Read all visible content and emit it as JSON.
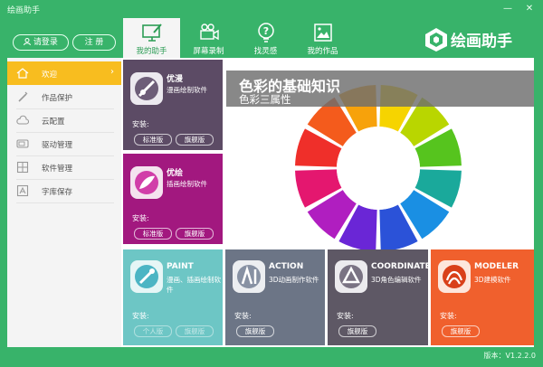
{
  "window": {
    "title": "绘画助手",
    "minimize_label": "—",
    "close_label": "✕"
  },
  "auth": {
    "login_label": "请登录",
    "register_label": "注 册"
  },
  "nav_tabs": [
    {
      "label": "我的助手",
      "icon": "monitor-brush-icon",
      "active": true
    },
    {
      "label": "屏幕录制",
      "icon": "video-camera-icon",
      "active": false
    },
    {
      "label": "找灵感",
      "icon": "question-bulb-icon",
      "active": false
    },
    {
      "label": "我的作品",
      "icon": "picture-icon",
      "active": false
    }
  ],
  "brand": {
    "name": "绘画助手"
  },
  "sidebar": {
    "items": [
      {
        "label": "欢迎",
        "icon": "house-icon",
        "active": true
      },
      {
        "label": "作品保护",
        "icon": "shield-icon",
        "active": false
      },
      {
        "label": "云配置",
        "icon": "cloud-icon",
        "active": false
      },
      {
        "label": "驱动管理",
        "icon": "tablet-icon",
        "active": false
      },
      {
        "label": "软件管理",
        "icon": "grid-icon",
        "active": false
      },
      {
        "label": "字库保存",
        "icon": "font-icon",
        "active": false
      }
    ],
    "chevron": "›"
  },
  "cards": {
    "youman": {
      "name": "优漫",
      "desc": "漫画绘制软件",
      "install_label": "安装:",
      "buttons": [
        "标准版",
        "旗舰版"
      ],
      "color": "#5c4b65"
    },
    "youhui": {
      "name": "优绘",
      "desc": "插画绘制软件",
      "install_label": "安装:",
      "buttons": [
        "标准版",
        "旗舰版"
      ],
      "color": "#a2187f"
    },
    "paint": {
      "name": "PAINT",
      "desc": "漫画、插画绘制软件",
      "install_label": "安装:",
      "buttons": [
        "个人版",
        "旗舰版"
      ],
      "color": "#6dc6c5"
    },
    "action": {
      "name": "ACTION",
      "desc": "3D动画制作软件",
      "install_label": "安装:",
      "buttons": [
        "旗舰版"
      ],
      "color": "#6c7586"
    },
    "coordinate": {
      "name": "COORDINATE",
      "desc": "3D角色编辑软件",
      "install_label": "安装:",
      "buttons": [
        "旗舰版"
      ],
      "color": "#5e5865"
    },
    "modeler": {
      "name": "MODELER",
      "desc": "3D建模软件",
      "install_label": "安装:",
      "buttons": [
        "旗舰版"
      ],
      "color": "#f0602d"
    }
  },
  "banner": {
    "title": "色彩的基础知识",
    "subtitle": "色彩三属性"
  },
  "status": {
    "version": "版本：V1.2.2.0"
  },
  "colors": {
    "primary_green": "#38b36a",
    "accent_yellow": "#f8bd1f"
  }
}
